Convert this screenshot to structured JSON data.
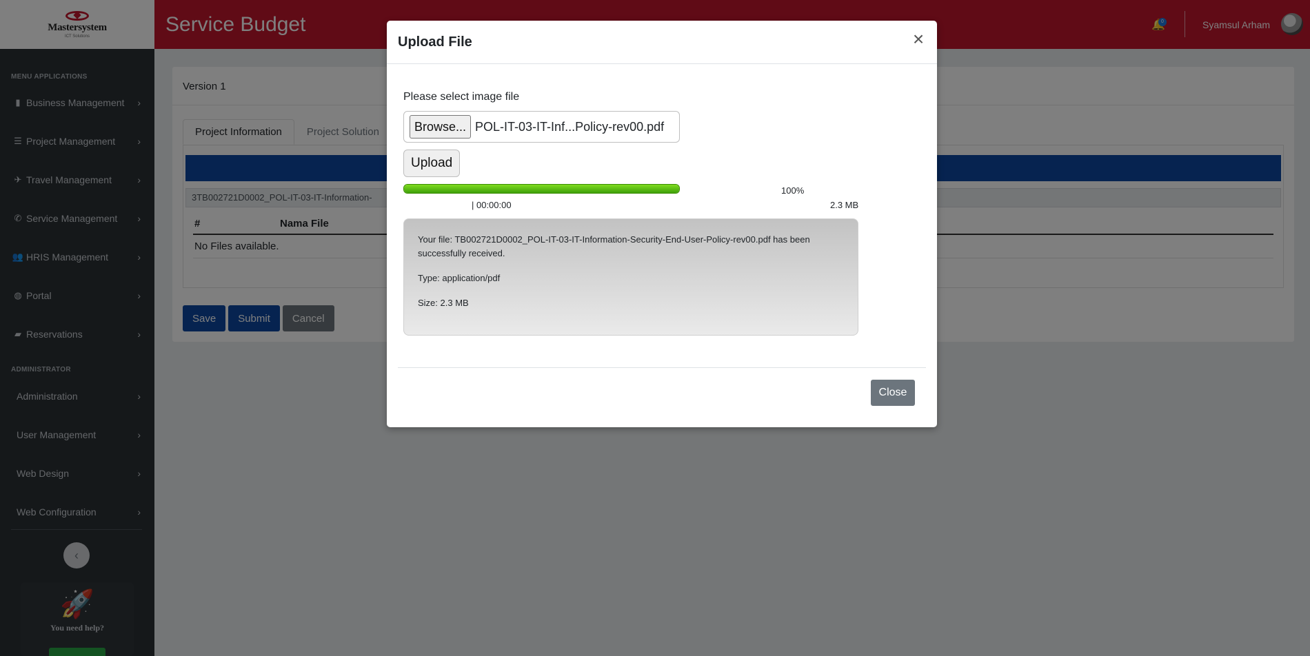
{
  "brand": {
    "name": "Mastersystem",
    "tagline": "ICT Solutions"
  },
  "sidebar": {
    "section_apps": "MENU APPLICATIONS",
    "apps": [
      {
        "label": "Business Management",
        "icon": "building-icon"
      },
      {
        "label": "Project Management",
        "icon": "list-icon"
      },
      {
        "label": "Travel Management",
        "icon": "plane-icon"
      },
      {
        "label": "Service Management",
        "icon": "phone-icon"
      },
      {
        "label": "HRIS Management",
        "icon": "users-icon"
      },
      {
        "label": "Portal",
        "icon": "globe-icon"
      },
      {
        "label": "Reservations",
        "icon": "bookmark-icon"
      }
    ],
    "section_admin": "ADMINISTRATOR",
    "admin": [
      {
        "label": "Administration"
      },
      {
        "label": "User Management"
      },
      {
        "label": "Web Design"
      },
      {
        "label": "Web Configuration"
      }
    ],
    "help_text": "You need help?"
  },
  "header": {
    "title": "Service Budget",
    "notification_count": "0",
    "user_name": "Syamsul Arham"
  },
  "content": {
    "version": "Version 1",
    "tabs": [
      {
        "label": "Project Information"
      },
      {
        "label": "Project Solution"
      }
    ],
    "file_path": "3TB002721D0002_POL-IT-03-IT-Information-",
    "table": {
      "col_num": "#",
      "col_name": "Nama File",
      "empty": "No Files available."
    },
    "buttons": {
      "save": "Save",
      "submit": "Submit",
      "cancel": "Cancel"
    }
  },
  "modal": {
    "title": "Upload File",
    "select_label": "Please select image file",
    "browse_label": "Browse...",
    "file_name": "POL-IT-03-IT-Inf...Policy-rev00.pdf",
    "upload_label": "Upload",
    "progress": 1.0,
    "percent_text": "100%",
    "timer_text": "| 00:00:00",
    "size_text": "2.3 MB",
    "result_line1": "Your file: TB002721D0002_POL-IT-03-IT-Information-Security-End-User-Policy-rev00.pdf has been successfully received.",
    "result_type": "Type: application/pdf",
    "result_size": "Size: 2.3 MB",
    "close_label": "Close"
  },
  "colors": {
    "header_red": "#c0162d",
    "sidebar_dark": "#2b3035",
    "primary_blue": "#0d47a1",
    "progress_green": "#3fa10a"
  }
}
